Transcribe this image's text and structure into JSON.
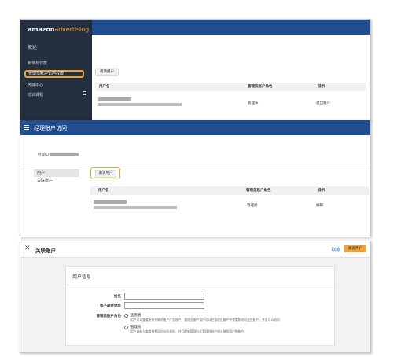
{
  "panel1": {
    "logo_brand": "amazon",
    "logo_product": "advertising",
    "sidebar_heading": "概述",
    "sidebar_items": [
      "账单与付款",
      "管理员账户访问权限",
      "支持中心",
      "培训课程"
    ],
    "invite_button": "邀请用户",
    "table_headers": [
      "用户名",
      "管理员账户角色",
      "操作"
    ],
    "row": {
      "role": "管理员",
      "action": "退出账户"
    },
    "colors": {
      "sidebar": "#232f3e",
      "topbar": "#1f4d8f",
      "highlight": "#f0a23a"
    }
  },
  "panel2": {
    "title": "经理账户访问",
    "account_label": "经理ID:",
    "nav_items": [
      "用户",
      "关联账户"
    ],
    "invite_button": "邀请用户",
    "table_headers": [
      "用户名",
      "管理员账户角色",
      "操作"
    ],
    "row": {
      "role": "管理员",
      "action": "编辑"
    }
  },
  "panel3": {
    "close_glyph": "✕",
    "title": "关联账户",
    "cancel": "取消",
    "invite_button": "邀请用户",
    "card_title": "用户信息",
    "fields": {
      "name_label": "姓名",
      "email_label": "电子邮件地址",
      "role_label": "管理员账户角色"
    },
    "options": [
      {
        "title": "查看者",
        "desc": "用户可以查看所有关联的账户广告账户。管理员账户用户可以在管理员账户中查看和访问这些账户，并且可以访问"
      },
      {
        "title": "管理员",
        "desc": "用户具有与查看者相同的访问权限，并且能够管理与此管理员账户相关联的用户和账户。"
      }
    ]
  }
}
